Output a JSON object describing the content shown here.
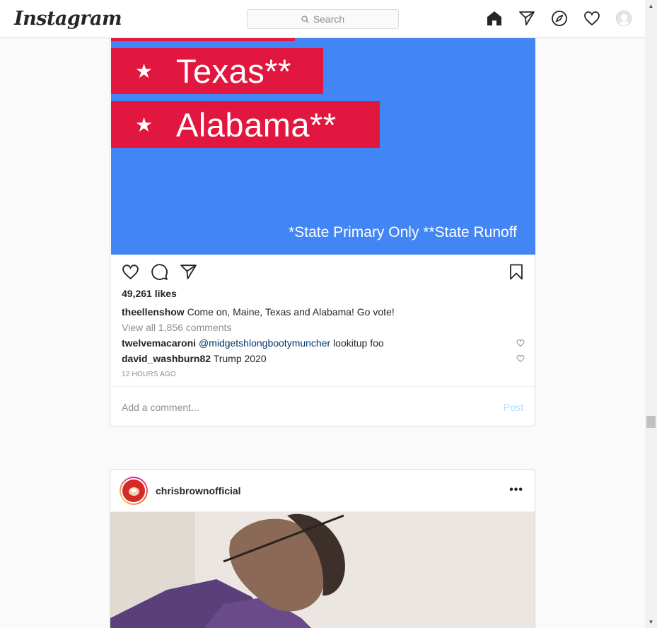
{
  "app": {
    "logo": "Instagram"
  },
  "search": {
    "placeholder": "Search"
  },
  "nav": {
    "icons": [
      "home-icon",
      "direct-icon",
      "explore-icon",
      "activity-icon",
      "profile-icon"
    ]
  },
  "post1": {
    "image": {
      "lines": [
        {
          "star": "★",
          "text": "Texas**"
        },
        {
          "star": "★",
          "text": "Alabama**"
        }
      ],
      "footnote": "*State Primary Only  **State Runoff"
    },
    "likes": "49,261 likes",
    "caption": {
      "user": "theellenshow",
      "text": "Come on, Maine, Texas and Alabama! Go vote!"
    },
    "view_all": "View all 1,856 comments",
    "comments": [
      {
        "user": "twelvemacaroni",
        "mention": "@midgetshlongbootymuncher",
        "text": "lookitup foo"
      },
      {
        "user": "david_washburn82",
        "mention": "",
        "text": "Trump 2020"
      }
    ],
    "time": "12 HOURS AGO",
    "add_comment_placeholder": "Add a comment...",
    "post_button": "Post"
  },
  "post2": {
    "username": "chrisbrownofficial",
    "more": "•••"
  },
  "colors": {
    "accent": "#0095f6",
    "post_disabled": "#b2dffc",
    "flag_red": "#e1173f",
    "flag_blue": "#4285f4"
  }
}
